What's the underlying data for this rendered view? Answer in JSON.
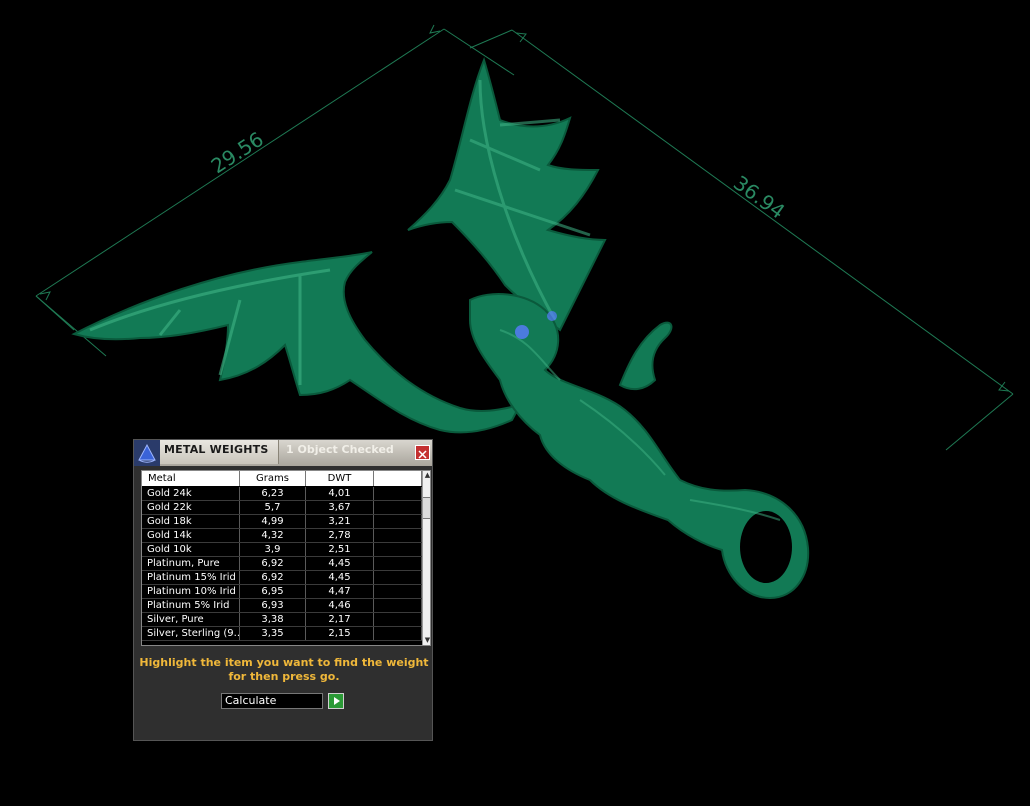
{
  "viewport": {
    "dimensions": [
      "29.56",
      "36.94"
    ],
    "model_color": "#127a55",
    "dimension_color": "#2a8a63"
  },
  "panel": {
    "title": "METAL WEIGHTS",
    "status": "1 Object Checked",
    "close_icon": "close-icon",
    "columns": [
      "Metal",
      "Grams",
      "DWT",
      ""
    ],
    "rows": [
      {
        "metal": "Gold 24k",
        "grams": "6,23",
        "dwt": "4,01"
      },
      {
        "metal": "Gold 22k",
        "grams": "5,7",
        "dwt": "3,67"
      },
      {
        "metal": "Gold 18k",
        "grams": "4,99",
        "dwt": "3,21"
      },
      {
        "metal": "Gold 14k",
        "grams": "4,32",
        "dwt": "2,78"
      },
      {
        "metal": "Gold 10k",
        "grams": "3,9",
        "dwt": "2,51"
      },
      {
        "metal": "Platinum, Pure",
        "grams": "6,92",
        "dwt": "4,45"
      },
      {
        "metal": "Platinum 15% Irid",
        "grams": "6,92",
        "dwt": "4,45"
      },
      {
        "metal": "Platinum 10% Irid",
        "grams": "6,95",
        "dwt": "4,47"
      },
      {
        "metal": "Platinum 5% Irid",
        "grams": "6,93",
        "dwt": "4,46"
      },
      {
        "metal": "Silver, Pure",
        "grams": "3,38",
        "dwt": "2,17"
      },
      {
        "metal": "Silver, Sterling (9...",
        "grams": "3,35",
        "dwt": "2,15"
      }
    ],
    "instruction": "Highlight the item you want to find the weight for then press go.",
    "calculate_label": "Calculate",
    "go_icon": "play-icon",
    "accent_color": "#f0b83a"
  }
}
